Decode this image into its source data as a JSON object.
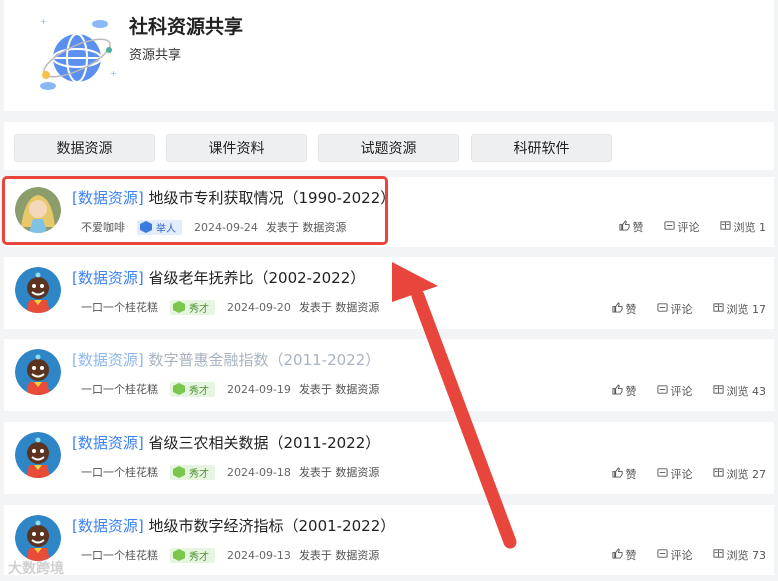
{
  "header": {
    "title": "社科资源共享",
    "subtitle": "资源共享"
  },
  "tabs": [
    "数据资源",
    "课件资料",
    "试题资源",
    "科研软件"
  ],
  "actions": {
    "like": "赞",
    "comment": "评论",
    "view_prefix": "浏览"
  },
  "posts": [
    {
      "category": "[数据资源]",
      "title": "地级市专利获取情况（1990-2022）",
      "author": "不爱咖啡",
      "badge": "举人",
      "badge_color": "blue",
      "date": "2024-09-24",
      "published_in": "发表于 数据资源",
      "views": "浏览 1",
      "muted": false,
      "avatar": "avatar-girl"
    },
    {
      "category": "[数据资源]",
      "title": "省级老年抚养比（2002-2022）",
      "author": "一口一个桂花糕",
      "badge": "秀才",
      "badge_color": "green",
      "date": "2024-09-20",
      "published_in": "发表于 数据资源",
      "views": "浏览 17",
      "muted": false,
      "avatar": "avatar-character"
    },
    {
      "category": "[数据资源]",
      "title": "数字普惠金融指数（2011-2022）",
      "author": "一口一个桂花糕",
      "badge": "秀才",
      "badge_color": "green",
      "date": "2024-09-19",
      "published_in": "发表于 数据资源",
      "views": "浏览 43",
      "muted": true,
      "avatar": "avatar-character"
    },
    {
      "category": "[数据资源]",
      "title": "省级三农相关数据（2011-2022）",
      "author": "一口一个桂花糕",
      "badge": "秀才",
      "badge_color": "green",
      "date": "2024-09-18",
      "published_in": "发表于 数据资源",
      "views": "浏览 27",
      "muted": false,
      "avatar": "avatar-character"
    },
    {
      "category": "[数据资源]",
      "title": "地级市数字经济指标（2001-2022）",
      "author": "一口一个桂花糕",
      "badge": "秀才",
      "badge_color": "green",
      "date": "2024-09-13",
      "published_in": "发表于 数据资源",
      "views": "浏览 73",
      "muted": false,
      "avatar": "avatar-character"
    }
  ],
  "watermark": "大数跨境",
  "colors": {
    "accent": "#3b82f6",
    "highlight": "#e8453c"
  }
}
